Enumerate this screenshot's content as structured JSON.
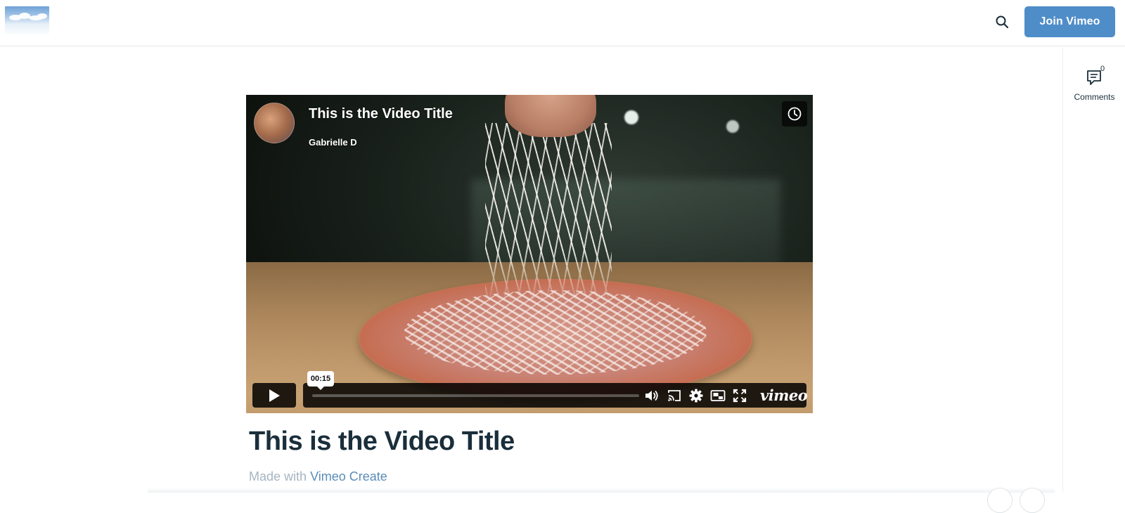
{
  "header": {
    "logo_alt": "",
    "join_label": "Join Vimeo",
    "accent": "#4f8dc9"
  },
  "rail": {
    "comments_count": "0",
    "comments_label": "Comments"
  },
  "player": {
    "title": "This is the Video Title",
    "author": "Gabrielle D",
    "tooltip_time": "00:15",
    "brand": "vimeo",
    "progress": 0
  },
  "page": {
    "title": "This is the Video Title",
    "made_with_prefix": "Made with",
    "made_with_link": "Vimeo Create"
  },
  "icons": [
    "search-icon",
    "comment-icon",
    "clock-icon",
    "play-icon",
    "volume-icon",
    "cast-icon",
    "gear-icon",
    "pip-icon",
    "fullscreen-icon"
  ]
}
